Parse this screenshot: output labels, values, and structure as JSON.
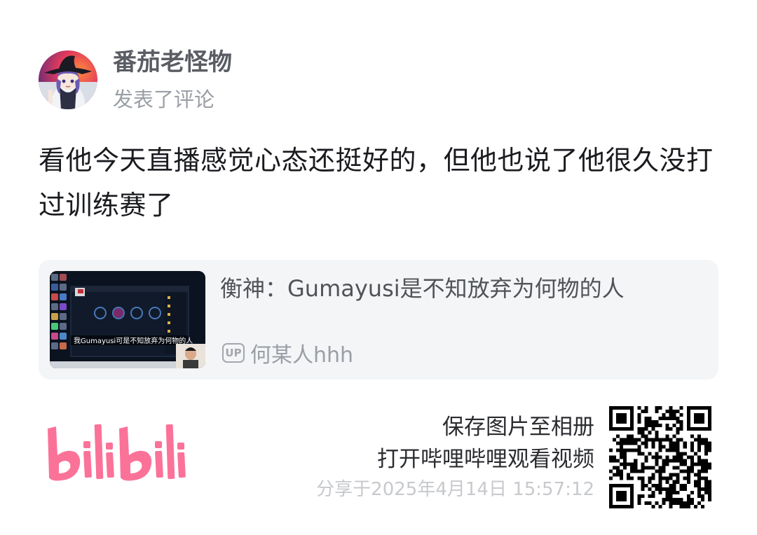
{
  "header": {
    "avatar_icon": "anime-witch-avatar",
    "username": "番茄老怪物",
    "action": "发表了评论"
  },
  "comment": {
    "text": "看他今天直播感觉心态还挺好的，但他也说了他很久没打过训练赛了"
  },
  "video_card": {
    "thumbnail_caption": "我Gumayusi可是不知放弃为何物的人",
    "title": "衡神：Gumayusi是不知放弃为何物的人",
    "up_badge": "UP",
    "uploader": "何某人hhh"
  },
  "footer": {
    "logo_text": "bilibili",
    "logo_color": "#fb7299",
    "line1": "保存图片至相册",
    "line2": "打开哔哩哔哩观看视频",
    "share_time": "分享于2025年4月14日 15:57:12",
    "qr_icon": "qr-code-icon"
  }
}
